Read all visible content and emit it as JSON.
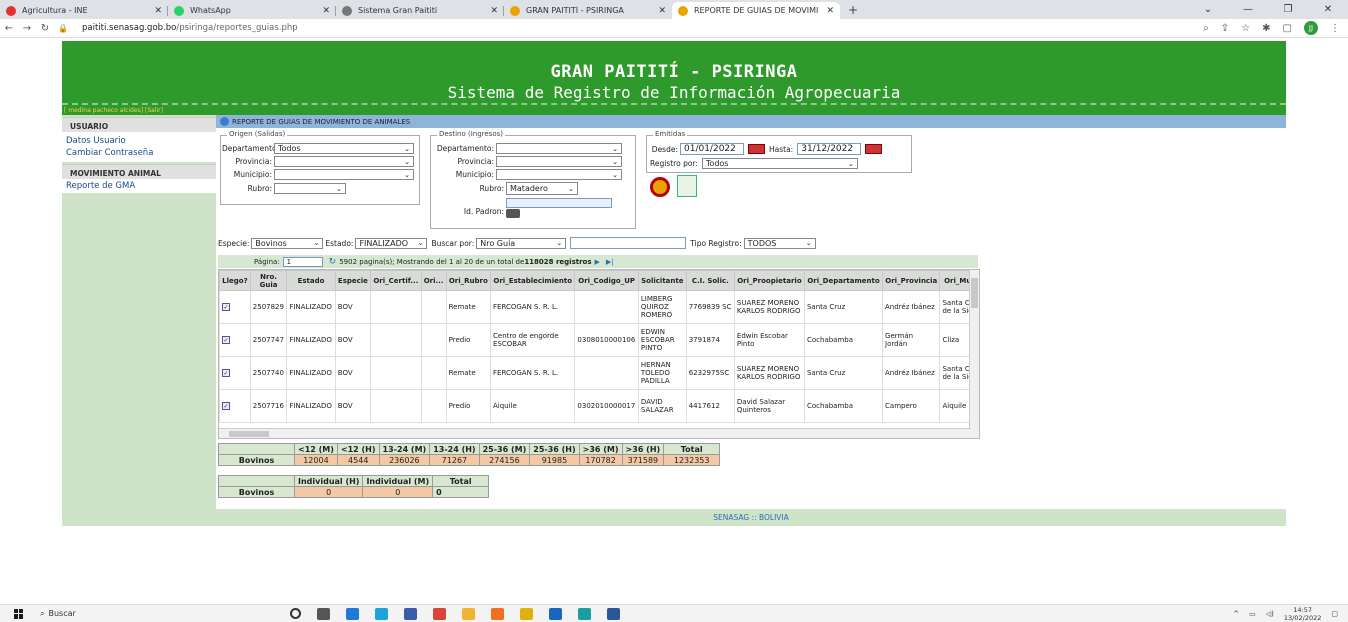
{
  "browser": {
    "tabs": [
      {
        "title": "Agricultura - INE",
        "color": "#d33"
      },
      {
        "title": "WhatsApp",
        "color": "#25d366"
      },
      {
        "title": "Sistema Gran Paititi",
        "color": "#777"
      },
      {
        "title": "GRAN PAITITÍ - PSIRINGA",
        "color": "#e8a400"
      },
      {
        "title": "REPORTE DE GUIAS DE MOVIMI",
        "color": "#e8a400"
      }
    ],
    "url_host": "paititi.senasag.gob.bo",
    "url_path": "/psiringa/reportes_guias.php"
  },
  "header": {
    "title": "GRAN PAITITÍ - PSIRINGA",
    "subtitle": "Sistema de Registro de Información Agropecuaria",
    "user_line": "[ medina pacheco alcides] [Salir]"
  },
  "sidebar": {
    "section1": "USUARIO",
    "link1": "Datos Usuario",
    "link2": "Cambiar Contraseña",
    "section2": "MOVIMIENTO ANIMAL",
    "link3": "Reporte de GMA"
  },
  "main": {
    "title": "REPORTE DE GUIAS DE MOVIMIENTO DE ANIMALES",
    "origen": {
      "legend": "Origen (Salidas)",
      "departamento_label": "Departamento:",
      "departamento": "Todos",
      "provincia_label": "Provincia:",
      "municipio_label": "Municipio:",
      "rubro_label": "Rubro:"
    },
    "destino": {
      "legend": "Destino (Ingresos)",
      "departamento_label": "Departamento:",
      "provincia_label": "Provincia:",
      "municipio_label": "Municipio:",
      "rubro_label": "Rubro:",
      "rubro": "Matadero",
      "padron_label": "Id. Padron:"
    },
    "emitidas": {
      "legend": "Emitidas",
      "desde_label": "Desde:",
      "desde": "01/01/2022",
      "hasta_label": "Hasta:",
      "hasta": "31/12/2022",
      "registro_label": "Registro por:",
      "registro": "Todos"
    },
    "filters": {
      "especie_label": "Especie:",
      "especie": "Bovinos",
      "estado_label": "Estado:",
      "estado": "FINALIZADO",
      "buscar_label": "Buscar por:",
      "buscar": "Nro Guía",
      "tipo_label": "Tipo Registro:",
      "tipo": "TODOS"
    },
    "pager": {
      "label": "Página:",
      "page": "1",
      "text": "5902 pagina(s);  Mostrando del 1 al 20 de un total de ",
      "total": "118028 registros"
    },
    "columns": [
      "Llego?",
      "Nro. Guia",
      "Estado",
      "Especie",
      "Ori_Certif...",
      "Ori...",
      "Ori_Rubro",
      "Ori_Establecimiento",
      "Ori_Codigo_UP",
      "Solicitante",
      "C.I. Solic.",
      "Ori_Proopietario",
      "Ori_Departamento",
      "Ori_Provincia",
      "Ori_Mun"
    ],
    "rows": [
      [
        "✓",
        "2507829",
        "FINALIZADO",
        "BOV",
        "",
        "",
        "Remate",
        "FERCOGAN S. R. L.",
        "",
        "LIMBERG QUIROZ ROMERO",
        "7769839 SC",
        "SUAREZ MORENO KARLOS RODRIGO",
        "Santa Cruz",
        "Andréz Ibánez",
        "Santa Cr de la Sie"
      ],
      [
        "✓",
        "2507747",
        "FINALIZADO",
        "BOV",
        "",
        "",
        "Predio",
        "Centro de engorde ESCOBAR",
        "0308010000106",
        "EDWIN ESCOBAR PINTO",
        "3791874",
        "Edwin Escobar Pinto",
        "Cochabamba",
        "Germán Jordán",
        "Cliza"
      ],
      [
        "✓",
        "2507740",
        "FINALIZADO",
        "BOV",
        "",
        "",
        "Remate",
        "FERCOGAN S. R. L.",
        "",
        "HERNAN TOLEDO PADILLA",
        "6232975SC",
        "SUAREZ MORENO KARLOS RODRIGO",
        "Santa Cruz",
        "Andréz Ibánez",
        "Santa Cr de la Sie"
      ],
      [
        "✓",
        "2507716",
        "FINALIZADO",
        "BOV",
        "",
        "",
        "Predio",
        "Aiquile",
        "0302010000017",
        "DAVID SALAZAR",
        "4417612",
        "David Salazar Quinteros",
        "Cochabamba",
        "Campero",
        "Aiquile"
      ]
    ],
    "summary1": {
      "headers": [
        "<12 (M)",
        "<12 (H)",
        "13-24 (M)",
        "13-24 (H)",
        "25-36 (M)",
        "25-36 (H)",
        ">36 (M)",
        ">36 (H)",
        "Total"
      ],
      "label": "Bovinos",
      "values": [
        "12004",
        "4544",
        "236026",
        "71267",
        "274156",
        "91985",
        "170782",
        "371589",
        "1232353"
      ]
    },
    "summary2": {
      "headers": [
        "Individual (H)",
        "Individual (M)",
        "Total"
      ],
      "label": "Bovinos",
      "values": [
        "0",
        "0",
        "0"
      ]
    },
    "footer": "SENASAG :: BOLIVIA"
  },
  "taskbar": {
    "search": "Buscar",
    "time": "14:57",
    "date": "13/02/2022"
  }
}
